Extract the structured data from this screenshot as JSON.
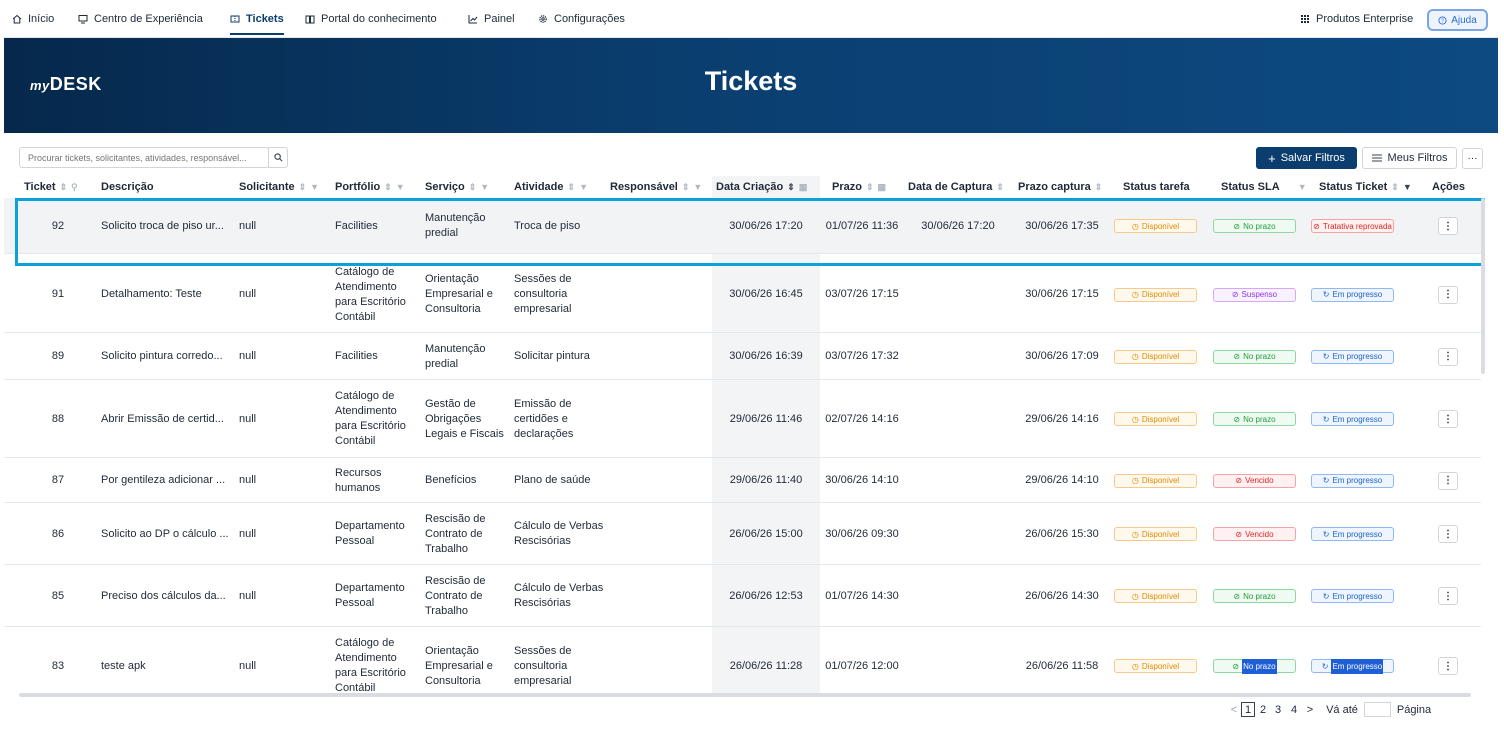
{
  "nav": {
    "items": [
      {
        "label": "Início",
        "icon": "home-icon"
      },
      {
        "label": "Centro de Experiência",
        "icon": "monitor-icon"
      },
      {
        "label": "Tickets",
        "icon": "ticket-icon"
      },
      {
        "label": "Portal do conhecimento",
        "icon": "book-icon"
      },
      {
        "label": "Painel",
        "icon": "chart-icon"
      },
      {
        "label": "Configurações",
        "icon": "gear-icon"
      }
    ],
    "products": "Produtos Enterprise",
    "help": "Ajuda"
  },
  "banner": {
    "logo_my": "my",
    "logo_desk": "DESK",
    "title": "Tickets"
  },
  "toolbar": {
    "search_placeholder": "Procurar tickets, solicitantes, atividades, responsável...",
    "save_filters": "Salvar Filtros",
    "my_filters": "Meus Filtros",
    "more": "···"
  },
  "columns": {
    "ticket": "Ticket",
    "descricao": "Descrição",
    "solicitante": "Solicitante",
    "portfolio": "Portfólio",
    "servico": "Serviço",
    "atividade": "Atividade",
    "responsavel": "Responsável",
    "data_criacao": "Data Criação",
    "prazo": "Prazo",
    "data_captura": "Data de Captura",
    "prazo_captura": "Prazo captura",
    "status_tarefa": "Status tarefa",
    "status_sla": "Status SLA",
    "status_ticket": "Status Ticket",
    "acoes": "Ações"
  },
  "rows": [
    {
      "ticket": "92",
      "descricao": "Solicito troca de piso ur...",
      "solicitante": "null",
      "portfolio": "Facilities",
      "servico": "Manutenção predial",
      "atividade": "Troca de piso",
      "responsavel": "",
      "data_criacao": "30/06/26 17:20",
      "prazo": "01/07/26 11:36",
      "data_captura": "30/06/26 17:20",
      "prazo_captura": "30/06/26 17:35",
      "status_tarefa": "Disponível",
      "status_sla": "No prazo",
      "status_ticket": "Tratativa reprovada"
    },
    {
      "ticket": "91",
      "descricao": "Detalhamento: Teste",
      "solicitante": "null",
      "portfolio": "Catálogo de Atendimento para Escritório Contábil",
      "servico": "Orientação Empresarial e Consultoria",
      "atividade": "Sessões de consultoria empresarial",
      "responsavel": "",
      "data_criacao": "30/06/26 16:45",
      "prazo": "03/07/26 17:15",
      "data_captura": "",
      "prazo_captura": "30/06/26 17:15",
      "status_tarefa": "Disponível",
      "status_sla": "Suspenso",
      "status_ticket": "Em progresso"
    },
    {
      "ticket": "89",
      "descricao": "Solicito pintura corredo...",
      "solicitante": "null",
      "portfolio": "Facilities",
      "servico": "Manutenção predial",
      "atividade": "Solicitar pintura",
      "responsavel": "",
      "data_criacao": "30/06/26 16:39",
      "prazo": "03/07/26 17:32",
      "data_captura": "",
      "prazo_captura": "30/06/26 17:09",
      "status_tarefa": "Disponível",
      "status_sla": "No prazo",
      "status_ticket": "Em progresso"
    },
    {
      "ticket": "88",
      "descricao": "Abrir Emissão de certid...",
      "solicitante": "null",
      "portfolio": "Catálogo de Atendimento para Escritório Contábil",
      "servico": "Gestão de Obrigações Legais e Fiscais",
      "atividade": "Emissão de certidões e declarações",
      "responsavel": "",
      "data_criacao": "29/06/26 11:46",
      "prazo": "02/07/26 14:16",
      "data_captura": "",
      "prazo_captura": "29/06/26 14:16",
      "status_tarefa": "Disponível",
      "status_sla": "No prazo",
      "status_ticket": "Em progresso"
    },
    {
      "ticket": "87",
      "descricao": "Por gentileza adicionar ...",
      "solicitante": "null",
      "portfolio": "Recursos humanos",
      "servico": "Benefícios",
      "atividade": "Plano de saúde",
      "responsavel": "",
      "data_criacao": "29/06/26 11:40",
      "prazo": "30/06/26 14:10",
      "data_captura": "",
      "prazo_captura": "29/06/26 14:10",
      "status_tarefa": "Disponível",
      "status_sla": "Vencido",
      "status_ticket": "Em progresso"
    },
    {
      "ticket": "86",
      "descricao": "Solicito ao DP o cálculo ...",
      "solicitante": "null",
      "portfolio": "Departamento Pessoal",
      "servico": "Rescisão de Contrato de Trabalho",
      "atividade": "Cálculo de Verbas Rescisórias",
      "responsavel": "",
      "data_criacao": "26/06/26 15:00",
      "prazo": "30/06/26 09:30",
      "data_captura": "",
      "prazo_captura": "26/06/26 15:30",
      "status_tarefa": "Disponível",
      "status_sla": "Vencido",
      "status_ticket": "Em progresso"
    },
    {
      "ticket": "85",
      "descricao": "Preciso dos cálculos da...",
      "solicitante": "null",
      "portfolio": "Departamento Pessoal",
      "servico": "Rescisão de Contrato de Trabalho",
      "atividade": "Cálculo de Verbas Rescisórias",
      "responsavel": "",
      "data_criacao": "26/06/26 12:53",
      "prazo": "01/07/26 14:30",
      "data_captura": "",
      "prazo_captura": "26/06/26 14:30",
      "status_tarefa": "Disponível",
      "status_sla": "No prazo",
      "status_ticket": "Em progresso"
    },
    {
      "ticket": "83",
      "descricao": "teste apk",
      "solicitante": "null",
      "portfolio": "Catálogo de Atendimento para Escritório Contábil",
      "servico": "Orientação Empresarial e Consultoria",
      "atividade": "Sessões de consultoria empresarial",
      "responsavel": "",
      "data_criacao": "26/06/26 11:28",
      "prazo": "01/07/26 12:00",
      "data_captura": "",
      "prazo_captura": "26/06/26 11:58",
      "status_tarefa": "Disponível",
      "status_sla": "No prazo",
      "status_ticket": "Em progresso"
    }
  ],
  "pagination": {
    "pages": [
      "1",
      "2",
      "3",
      "4"
    ],
    "current": "1",
    "goto_label": "Vá até",
    "page_label": "Página",
    "prev": "<",
    "next": ">"
  },
  "colors": {
    "brand": "#0b3d6e",
    "highlight": "#0aa2d8"
  }
}
